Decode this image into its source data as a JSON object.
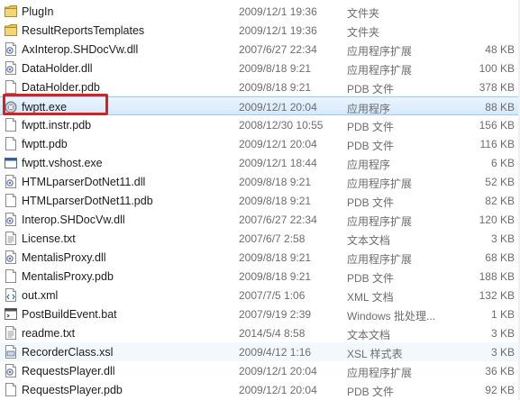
{
  "files": [
    {
      "name": "PlugIn",
      "date": "2009/12/1 19:36",
      "type": "文件夹",
      "size": "",
      "icon": "folder-icon"
    },
    {
      "name": "ResultReportsTemplates",
      "date": "2009/12/1 19:36",
      "type": "文件夹",
      "size": "",
      "icon": "folder-icon"
    },
    {
      "name": "AxInterop.SHDocVw.dll",
      "date": "2007/6/27 22:34",
      "type": "应用程序扩展",
      "size": "48 KB",
      "icon": "dll-icon"
    },
    {
      "name": "DataHolder.dll",
      "date": "2009/8/18 9:21",
      "type": "应用程序扩展",
      "size": "100 KB",
      "icon": "dll-icon"
    },
    {
      "name": "DataHolder.pdb",
      "date": "2009/8/18 9:21",
      "type": "PDB 文件",
      "size": "378 KB",
      "icon": "file-icon"
    },
    {
      "name": "fwptt.exe",
      "date": "2009/12/1 20:04",
      "type": "应用程序",
      "size": "88 KB",
      "icon": "exe-icon"
    },
    {
      "name": "fwptt.instr.pdb",
      "date": "2008/12/30 10:55",
      "type": "PDB 文件",
      "size": "156 KB",
      "icon": "file-icon"
    },
    {
      "name": "fwptt.pdb",
      "date": "2009/12/1 20:04",
      "type": "PDB 文件",
      "size": "116 KB",
      "icon": "file-icon"
    },
    {
      "name": "fwptt.vshost.exe",
      "date": "2009/12/1 18:44",
      "type": "应用程序",
      "size": "6 KB",
      "icon": "app-window-icon"
    },
    {
      "name": "HTMLparserDotNet11.dll",
      "date": "2009/8/18 9:21",
      "type": "应用程序扩展",
      "size": "52 KB",
      "icon": "dll-icon"
    },
    {
      "name": "HTMLparserDotNet11.pdb",
      "date": "2009/8/18 9:21",
      "type": "PDB 文件",
      "size": "82 KB",
      "icon": "file-icon"
    },
    {
      "name": "Interop.SHDocVw.dll",
      "date": "2007/6/27 22:34",
      "type": "应用程序扩展",
      "size": "120 KB",
      "icon": "dll-icon"
    },
    {
      "name": "License.txt",
      "date": "2007/6/7 2:58",
      "type": "文本文档",
      "size": "3 KB",
      "icon": "text-file-icon"
    },
    {
      "name": "MentalisProxy.dll",
      "date": "2009/8/18 9:21",
      "type": "应用程序扩展",
      "size": "68 KB",
      "icon": "dll-icon"
    },
    {
      "name": "MentalisProxy.pdb",
      "date": "2009/8/18 9:21",
      "type": "PDB 文件",
      "size": "188 KB",
      "icon": "file-icon"
    },
    {
      "name": "out.xml",
      "date": "2007/7/5 1:06",
      "type": "XML 文档",
      "size": "132 KB",
      "icon": "xml-file-icon"
    },
    {
      "name": "PostBuildEvent.bat",
      "date": "2007/9/19 2:39",
      "type": "Windows 批处理...",
      "size": "1 KB",
      "icon": "batch-file-icon"
    },
    {
      "name": "readme.txt",
      "date": "2014/5/4 8:58",
      "type": "文本文档",
      "size": "3 KB",
      "icon": "text-file-icon"
    },
    {
      "name": "RecorderClass.xsl",
      "date": "2009/4/12 1:16",
      "type": "XSL 样式表",
      "size": "3 KB",
      "icon": "xsl-file-icon"
    },
    {
      "name": "RequestsPlayer.dll",
      "date": "2009/12/1 20:04",
      "type": "应用程序扩展",
      "size": "36 KB",
      "icon": "dll-icon"
    },
    {
      "name": "RequestsPlayer.pdb",
      "date": "2009/12/1 20:04",
      "type": "PDB 文件",
      "size": "92 KB",
      "icon": "file-icon"
    }
  ],
  "selected_index": 5,
  "hover_index": 18,
  "colors": {
    "selection": "#d5e9fb",
    "highlight_box": "#d82020",
    "folder": "#e8c25a"
  }
}
